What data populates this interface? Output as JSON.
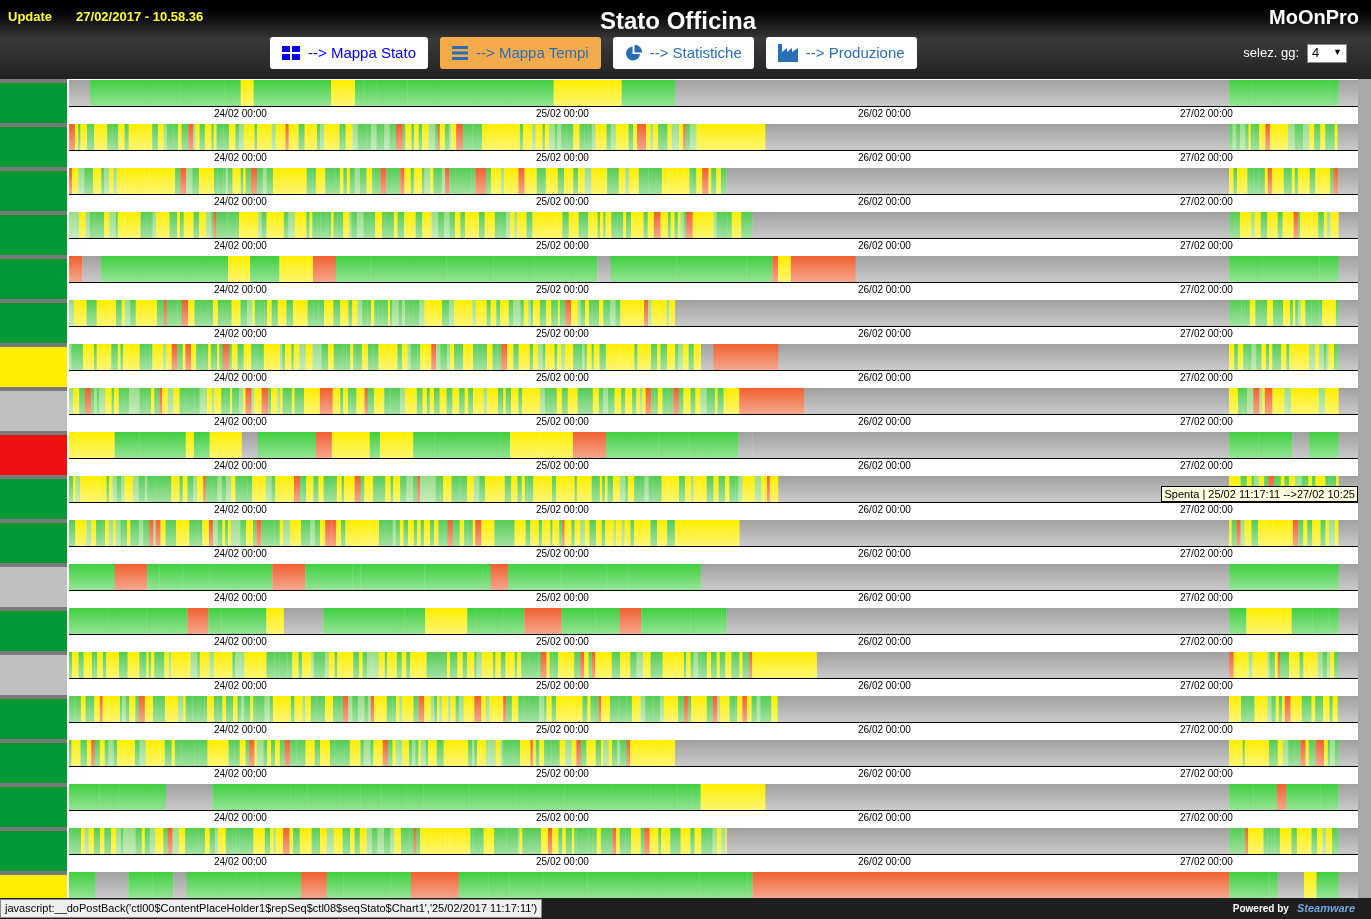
{
  "header": {
    "update_label": "Update",
    "update_time": "27/02/2017 - 10.58.36",
    "title": "Stato Officina",
    "brand": "MoOnPro"
  },
  "nav": [
    {
      "kind": "grid",
      "label": "--> Mappa Stato",
      "selected": false
    },
    {
      "kind": "list",
      "label": "--> Mappa Tempi",
      "selected": true
    },
    {
      "kind": "pie",
      "label": "--> Statistiche",
      "selected": false
    },
    {
      "kind": "factory",
      "label": "--> Produzione",
      "selected": false
    }
  ],
  "days_select": {
    "label": "selez. gg:",
    "value": "4",
    "caret": "▼"
  },
  "rows": [
    {
      "color": "#009933",
      "axis": [
        "24/02 00:00",
        "25/02 00:00",
        "26/02 00:00",
        "27/02 00:00"
      ]
    },
    {
      "color": "#009933",
      "axis": [
        "24/02 00:00",
        "25/02 00:00",
        "26/02 00:00",
        "27/02 00:00"
      ]
    },
    {
      "color": "#009933",
      "axis": [
        "24/02 00:00",
        "25/02 00:00",
        "26/02 00:00",
        "27/02 00:00"
      ]
    },
    {
      "color": "#009933",
      "axis": [
        "24/02 00:00",
        "25/02 00:00",
        "26/02 00:00",
        "27/02 00:00"
      ]
    },
    {
      "color": "#009933",
      "axis": [
        "24/02 00:00",
        "25/02 00:00",
        "26/02 00:00",
        "27/02 00:00"
      ]
    },
    {
      "color": "#009933",
      "axis": [
        "24/02 00:00",
        "25/02 00:00",
        "26/02 00:00",
        "27/02 00:00"
      ]
    },
    {
      "color": "#ffee00",
      "axis": [
        "24/02 00:00",
        "25/02 00:00",
        "26/02 00:00",
        "27/02 00:00"
      ]
    },
    {
      "color": "#c0c0c0",
      "axis": [
        "24/02 00:00",
        "25/02 00:00",
        "26/02 00:00",
        "27/02 00:00"
      ]
    },
    {
      "color": "#ee1111",
      "axis": [
        "24/02 00:00",
        "25/02 00:00",
        "26/02 00:00",
        "27/02 00:00"
      ]
    },
    {
      "color": "#009933",
      "axis": [
        "24/02 00:00",
        "25/02 00:00",
        "26/02 00:00",
        "27/02 00:00"
      ]
    },
    {
      "color": "#009933",
      "axis": [
        "24/02 00:00",
        "25/02 00:00",
        "26/02 00:00",
        "27/02 00:00"
      ]
    },
    {
      "color": "#c0c0c0",
      "axis": [
        "24/02 00:00",
        "25/02 00:00",
        "26/02 00:00",
        "27/02 00:00"
      ]
    },
    {
      "color": "#009933",
      "axis": [
        "24/02 00:00",
        "25/02 00:00",
        "26/02 00:00",
        "27/02 00:00"
      ]
    },
    {
      "color": "#c0c0c0",
      "axis": [
        "24/02 00:00",
        "25/02 00:00",
        "26/02 00:00",
        "27/02 00:00"
      ]
    },
    {
      "color": "#009933",
      "axis": [
        "24/02 00:00",
        "25/02 00:00",
        "26/02 00:00",
        "27/02 00:00"
      ]
    },
    {
      "color": "#009933",
      "axis": [
        "24/02 00:00",
        "25/02 00:00",
        "26/02 00:00",
        "27/02 00:00"
      ]
    },
    {
      "color": "#009933",
      "axis": [
        "24/02 00:00",
        "25/02 00:00",
        "26/02 00:00",
        "27/02 00:00"
      ]
    },
    {
      "color": "#009933",
      "axis": [
        "24/02 00:00",
        "25/02 00:00",
        "26/02 00:00",
        "27/02 00:00"
      ]
    },
    {
      "color": "#ffee00"
    }
  ],
  "tooltip": "Spenta | 25/02 11:17:11 -->27/02 10:25",
  "status_bar": {
    "url": "javascript:__doPostBack('ctl00$ContentPlaceHolder1$repSeq$ctl08$seqStato$Chart1','25/02/2017 11:17:11')",
    "powered_by": "Powered by",
    "logo": "Steamware"
  }
}
